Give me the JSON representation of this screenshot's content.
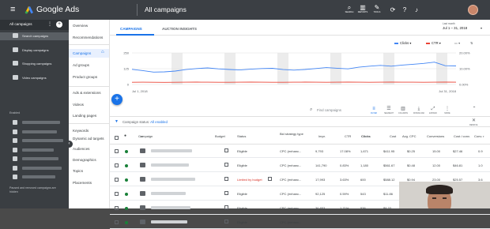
{
  "app": {
    "brand": "Google Ads",
    "page_title": "All campaigns"
  },
  "topbar_icons": [
    {
      "icon": "search-icon",
      "glyph": "⌕",
      "label": "SEARCH"
    },
    {
      "icon": "reports-icon",
      "glyph": "▥",
      "label": "REPORTS"
    },
    {
      "icon": "tools-icon",
      "glyph": "✎",
      "label": "TOOLS"
    },
    {
      "icon": "refresh-icon",
      "glyph": "⟳",
      "label": ""
    },
    {
      "icon": "help-icon",
      "glyph": "?",
      "label": ""
    },
    {
      "icon": "bell-icon",
      "glyph": "♪",
      "label": ""
    }
  ],
  "sidebar": {
    "header": "All campaigns",
    "items": [
      {
        "label": "Search campaigns",
        "icon": "search-icon"
      },
      {
        "label": "Display campaigns",
        "icon": "display-icon"
      },
      {
        "label": "Shopping campaigns",
        "icon": "shopping-icon"
      },
      {
        "label": "Video campaigns",
        "icon": "video-icon"
      }
    ],
    "section_label": "Enabled",
    "footer": "Paused and removed campaigns are hidden"
  },
  "nav": {
    "items": [
      "Overview",
      "Recommendations",
      "Campaigns",
      "Ad groups",
      "Product groups",
      "Ads & extensions",
      "Videos",
      "Landing pages",
      "Keywords",
      "Dynamic ad targets",
      "Audiences",
      "Demographics",
      "Topics",
      "Placements"
    ],
    "active_index": 2
  },
  "tabs": [
    "CAMPAIGNS",
    "AUCTION INSIGHTS"
  ],
  "date_range": {
    "label": "Last month",
    "value": "Jul 1 – 31, 2018"
  },
  "metrics": [
    {
      "name": "Clicks",
      "color": "#4285f4"
    },
    {
      "name": "CTR",
      "color": "#ea4335"
    }
  ],
  "chart_data": {
    "type": "line",
    "x_start_label": "Jul 1, 2018",
    "x_end_label": "Jul 31, 2018",
    "left_ticks": [
      "250",
      "125",
      "0"
    ],
    "right_ticks": [
      "20.00%",
      "10.00%",
      "0.00%"
    ],
    "ylim_left": [
      0,
      250
    ],
    "ylim_right": [
      0,
      20
    ],
    "series": [
      {
        "name": "Clicks",
        "color": "#4285f4",
        "values": [
          120,
          110,
          98,
          100,
          106,
          118,
          126,
          131,
          124,
          119,
          115,
          121,
          126,
          128,
          118,
          114,
          119,
          126,
          134,
          129,
          124,
          137,
          145,
          151,
          145,
          154,
          160,
          167,
          177,
          149,
          147
        ]
      },
      {
        "name": "CTR",
        "color": "#ea4335",
        "values": [
          1.4,
          1.45,
          1.4,
          1.35,
          1.4,
          1.45,
          1.5,
          1.45,
          1.4,
          1.42,
          1.45,
          1.5,
          1.45,
          1.4,
          1.42,
          1.45,
          1.5,
          1.46,
          1.42,
          1.45,
          1.5,
          1.45,
          1.42,
          1.45,
          1.5,
          1.46,
          1.44,
          1.42,
          1.45,
          1.5,
          1.45
        ]
      }
    ]
  },
  "toolbar": {
    "search_placeholder": "Find campaigns",
    "tools": [
      {
        "icon": "filter-icon",
        "glyph": "≡",
        "label": "FILTER"
      },
      {
        "icon": "segment-icon",
        "glyph": "☰",
        "label": "SEGMENT"
      },
      {
        "icon": "columns-icon",
        "glyph": "▥",
        "label": "COLUMNS"
      },
      {
        "icon": "download-icon",
        "glyph": "⤓",
        "label": "DOWNLOAD"
      },
      {
        "icon": "expand-icon",
        "glyph": "⤢",
        "label": "EXPAND"
      },
      {
        "icon": "more-icon",
        "glyph": "⋮",
        "label": "MORE"
      },
      {
        "icon": "collapse-icon",
        "glyph": "⌃",
        "label": ""
      }
    ]
  },
  "filter": {
    "prefix": "Campaign status:",
    "value": "All enabled",
    "remove_label": "REMOVE"
  },
  "table": {
    "columns": [
      "Campaign",
      "Budget",
      "Status",
      "Bid strategy type",
      "Impr.",
      "CTR",
      "Clicks",
      "Cost",
      "Avg. CPC",
      "Conversions",
      "Cost / conv.",
      "Conv. r"
    ],
    "rows": [
      {
        "status": "Eligible",
        "limited": false,
        "bid": "CPC (enhanc...",
        "impr": "9,793",
        "ctr": "17.08%",
        "clicks": "1,671",
        "cost": "$411.95",
        "cpc": "$0.25",
        "conv": "15.00",
        "cpa": "$27.46",
        "rate": "0.9"
      },
      {
        "status": "Eligible",
        "limited": false,
        "bid": "CPC (enhanc...",
        "impr": "141,790",
        "ctr": "0.83%",
        "clicks": "1,180",
        "cost": "$561.67",
        "cpc": "$0.48",
        "conv": "12.00",
        "cpa": "$46.81",
        "rate": "1.0"
      },
      {
        "status": "Limited by budget",
        "limited": true,
        "bid": "CPC (enhanc...",
        "impr": "17,993",
        "ctr": "3.63%",
        "clicks": "600",
        "cost": "$588.12",
        "cpc": "$0.94",
        "conv": "23.00",
        "cpa": "$25.57",
        "rate": "3.6"
      },
      {
        "status": "Eligible",
        "limited": false,
        "bid": "CPC (enhanc...",
        "impr": "92,125",
        "ctr": "0.59%",
        "clicks": "543",
        "cost": "$11.86",
        "cpc": "",
        "conv": "",
        "cpa": "",
        "rate": ""
      },
      {
        "status": "Eligible",
        "limited": false,
        "bid": "CPC (enhanc...",
        "impr": "36,853",
        "ctr": "1.71%",
        "clicks": "536",
        "cost": "$8.33",
        "cpc": "",
        "conv": "",
        "cpa": "",
        "rate": ""
      },
      {
        "status": "Eligible",
        "limited": false,
        "bid": "CPC (enhanc...",
        "impr": "",
        "ctr": "",
        "clicks": "",
        "cost": "",
        "cpc": "",
        "conv": "",
        "cpa": "",
        "rate": ""
      }
    ]
  }
}
